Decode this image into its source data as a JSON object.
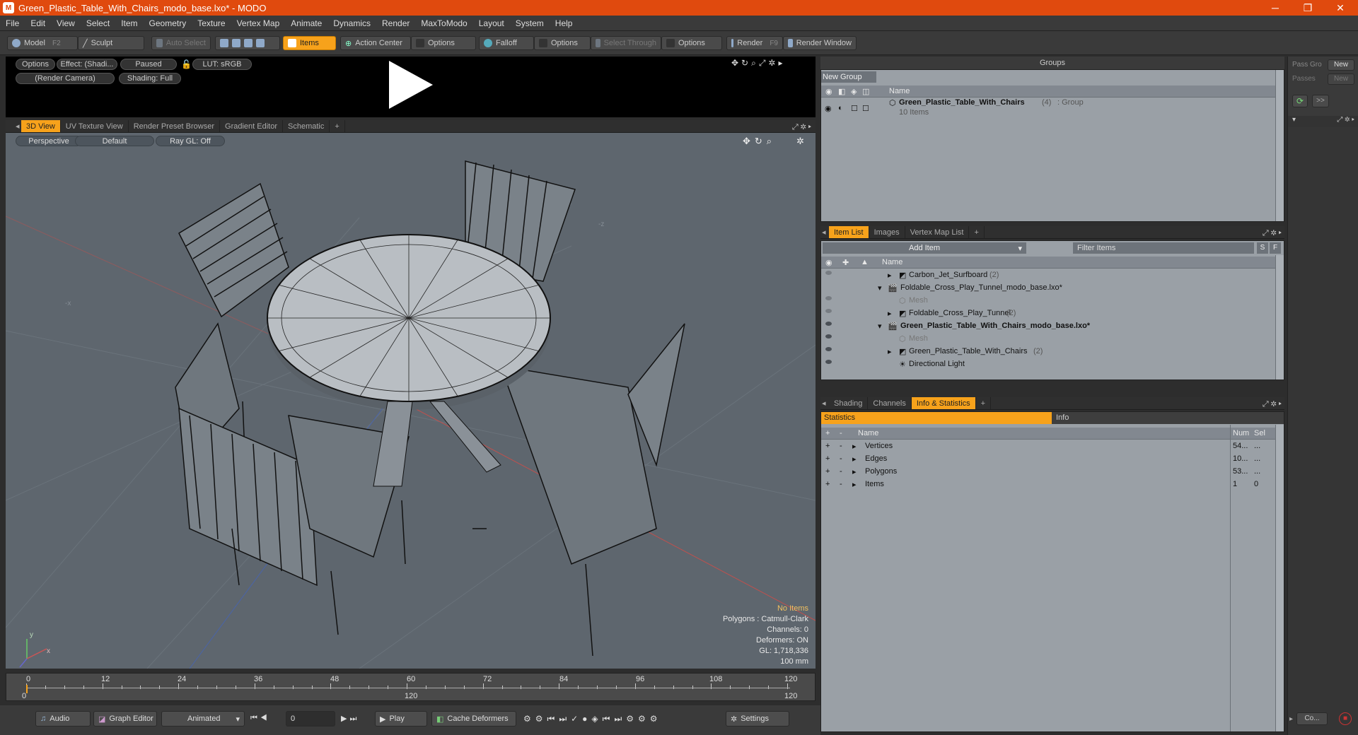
{
  "window": {
    "title": "Green_Plastic_Table_With_Chairs_modo_base.lxo* - MODO",
    "app_icon": "modo-logo-icon",
    "minimize": "─",
    "maximize": "❐",
    "close": "✕"
  },
  "menu": [
    "File",
    "Edit",
    "View",
    "Select",
    "Item",
    "Geometry",
    "Texture",
    "Vertex Map",
    "Animate",
    "Dynamics",
    "Render",
    "MaxToModo",
    "Layout",
    "System",
    "Help"
  ],
  "toolbar": {
    "model": "Model",
    "model_key": "F2",
    "sculpt": "Sculpt",
    "auto_select": "Auto Select",
    "items": "Items",
    "action_center": "Action Center",
    "options1": "Options",
    "falloff": "Falloff",
    "options2": "Options",
    "select_through": "Select Through",
    "options3": "Options",
    "render": "Render",
    "render_key": "F9",
    "render_window": "Render Window"
  },
  "anim": {
    "options": "Options",
    "effect": "Effect: (Shadi...",
    "paused": "Paused",
    "lut": "LUT: sRGB",
    "camera": "(Render Camera)",
    "shading": "Shading: Full"
  },
  "viewport_tabs": [
    "3D View",
    "UV Texture View",
    "Render Preset Browser",
    "Gradient Editor",
    "Schematic",
    "+"
  ],
  "viewport": {
    "perspective": "Perspective",
    "default": "Default",
    "raygl": "Ray GL: Off",
    "axis_y": "y",
    "axis_x": "x",
    "axis_neg_x": "-x",
    "axis_neg_z": "-z"
  },
  "hud": {
    "no_items": "No Items",
    "polygons": "Polygons : Catmull-Clark",
    "channels": "Channels: 0",
    "deformers": "Deformers: ON",
    "gl": "GL: 1,718,336",
    "scale": "100 mm"
  },
  "timeline": {
    "ticks": [
      "0",
      "12",
      "24",
      "36",
      "48",
      "60",
      "72",
      "84",
      "96",
      "108",
      "120"
    ],
    "range_start": "0",
    "range_mid": "120",
    "range_end": "120"
  },
  "bottom": {
    "audio": "Audio",
    "graph_editor": "Graph Editor",
    "animated": "Animated",
    "frame": "0",
    "play": "Play",
    "cache": "Cache Deformers",
    "settings": "Settings"
  },
  "groups": {
    "title": "Groups",
    "new_group": "New Group",
    "col_name": "Name",
    "item_name": "Green_Plastic_Table_With_Chairs",
    "item_count": "(4)",
    "item_type": ": Group",
    "item_sub": "10 Items"
  },
  "right_col": {
    "pass_group": "Pass Gro",
    "new1": "New",
    "passes": "Passes",
    "new2": "New",
    "expand": ">>",
    "co": "Co..."
  },
  "itemlist": {
    "tabs": [
      "Item List",
      "Images",
      "Vertex Map List",
      "+"
    ],
    "add_item": "Add Item",
    "filter": "Filter Items",
    "f_s": "S",
    "f_f": "F",
    "col_name": "Name",
    "rows": [
      {
        "label": "Carbon_Jet_Surfboard",
        "count": "(2)"
      },
      {
        "label": "Foldable_Cross_Play_Tunnel_modo_base.lxo*",
        "count": ""
      },
      {
        "label": "Mesh",
        "count": ""
      },
      {
        "label": "Foldable_Cross_Play_Tunnel",
        "count": "(2)"
      },
      {
        "label": "Green_Plastic_Table_With_Chairs_modo_base.lxo*",
        "count": ""
      },
      {
        "label": "Mesh",
        "count": ""
      },
      {
        "label": "Green_Plastic_Table_With_Chairs",
        "count": "(2)"
      },
      {
        "label": "Directional Light",
        "count": ""
      }
    ]
  },
  "stats": {
    "tabs": [
      "Shading",
      "Channels",
      "Info & Statistics",
      "+"
    ],
    "statistics": "Statistics",
    "info": "Info",
    "col_name": "Name",
    "col_num": "Num",
    "col_sel": "Sel",
    "rows": [
      {
        "name": "Vertices",
        "num": "54...",
        "sel": "..."
      },
      {
        "name": "Edges",
        "num": "10...",
        "sel": "..."
      },
      {
        "name": "Polygons",
        "num": "53...",
        "sel": "..."
      },
      {
        "name": "Items",
        "num": "1",
        "sel": "0"
      }
    ]
  }
}
